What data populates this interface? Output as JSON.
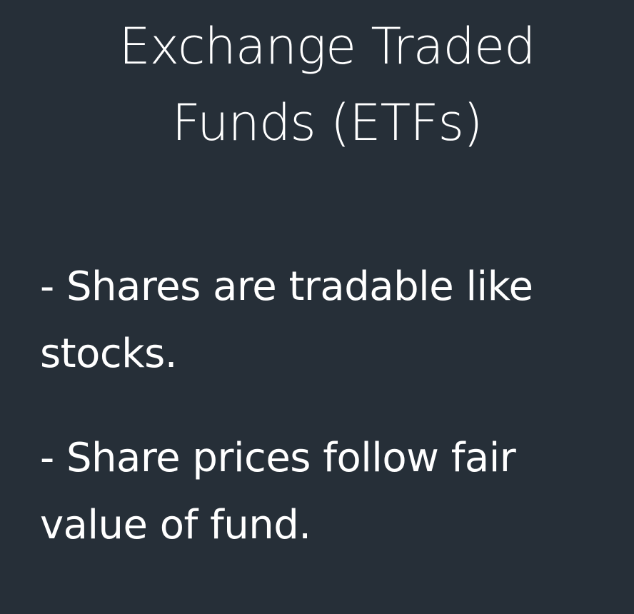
{
  "slide": {
    "title_lines": [
      "Exchange Traded",
      "Funds (ETFs)"
    ],
    "bullets": [
      {
        "lines": [
          "- Shares are tradable like",
          "stocks."
        ]
      },
      {
        "lines": [
          "- Share prices follow fair",
          "value of fund."
        ]
      }
    ]
  }
}
